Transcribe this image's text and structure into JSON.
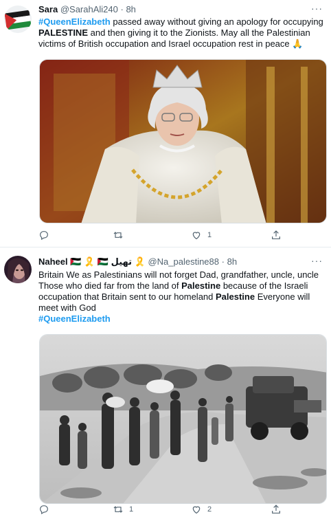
{
  "tweets": [
    {
      "name": "Sara",
      "handle": "@SarahAli240",
      "sep": "·",
      "time": "8h",
      "more": "···",
      "text_parts": [
        {
          "text": "#QueenElizabeth",
          "style": "hashtag"
        },
        {
          "text": " passed away without giving an apology for occupying ",
          "style": "plain"
        },
        {
          "text": "PALESTINE",
          "style": "bold"
        },
        {
          "text": " and then giving it to the Zionists. May all the Palestinian victims of British occupation and Israel occupation rest in peace 🙏",
          "style": "plain"
        }
      ],
      "reply_count": "",
      "retweet_count": "",
      "like_count": "1"
    },
    {
      "name": "Naheel 🇵🇸 🎗️ 🇵🇸 تهيل 🎗️",
      "handle": "@Na_palestine88",
      "sep": "·",
      "time": "8h",
      "more": "···",
      "text_parts": [
        {
          "text": "Britain We as Palestinians will not forget Dad, grandfather, uncle, uncle Those who died far from the land of ",
          "style": "plain"
        },
        {
          "text": "Palestine",
          "style": "bold"
        },
        {
          "text": " because of the Israeli occupation that Britain sent to our homeland ",
          "style": "plain"
        },
        {
          "text": "Palestine",
          "style": "bold"
        },
        {
          "text": " Everyone will meet with God",
          "style": "plain"
        },
        {
          "text": "\n",
          "style": "break"
        },
        {
          "text": "#QueenElizabeth",
          "style": "hashtag"
        }
      ],
      "reply_count": "",
      "retweet_count": "1",
      "like_count": "2"
    }
  ],
  "colors": {
    "accent": "#1d9bf0",
    "muted": "#536471",
    "text": "#0f1419",
    "divider": "#e6ecf0"
  },
  "icons": [
    "reply-icon",
    "retweet-icon",
    "like-icon",
    "share-icon",
    "more-icon"
  ]
}
